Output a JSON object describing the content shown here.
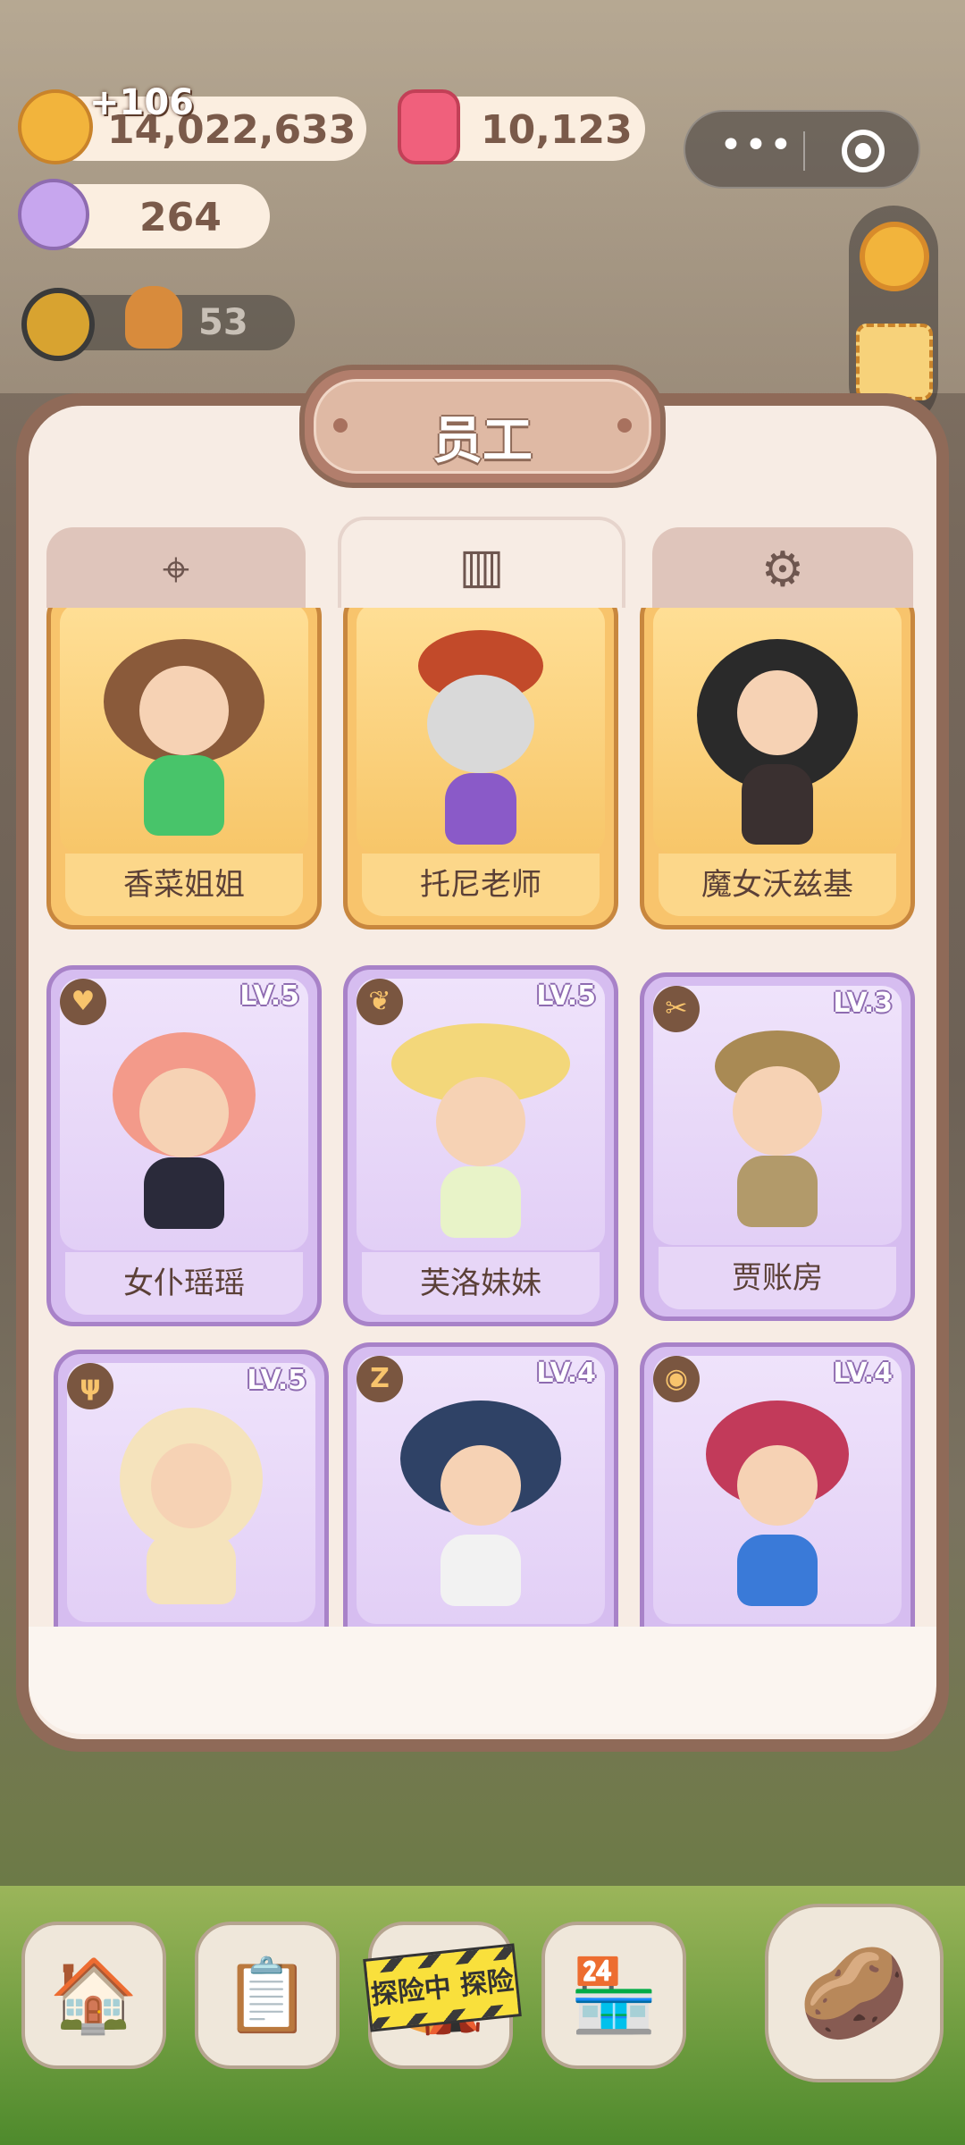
{
  "hud": {
    "coins_value": "14,022,633",
    "coins_gain": "+106",
    "candles_value": "10,123",
    "gems_value": "264",
    "sub_value": "53"
  },
  "capsule": {
    "more_label": "•••"
  },
  "panel": {
    "title": "员工",
    "tabs": [
      {
        "icon": "map-pin-icon"
      },
      {
        "icon": "book-icon",
        "active": true
      },
      {
        "icon": "gear-icon"
      }
    ]
  },
  "staff": [
    {
      "name": "香菜姐姐",
      "level": "",
      "rarity": "gold"
    },
    {
      "name": "托尼老师",
      "level": "",
      "rarity": "gold"
    },
    {
      "name": "魔女沃兹基",
      "level": "",
      "rarity": "gold"
    },
    {
      "name": "女仆瑶瑶",
      "level": "LV.5",
      "rarity": "purple",
      "badge": "♥"
    },
    {
      "name": "芙洛妹妹",
      "level": "LV.5",
      "rarity": "purple",
      "badge": "❦"
    },
    {
      "name": "贾账房",
      "level": "LV.3",
      "rarity": "purple",
      "badge": "✂"
    },
    {
      "name": "",
      "level": "LV.5",
      "rarity": "purple",
      "badge": "ψ"
    },
    {
      "name": "",
      "level": "LV.4",
      "rarity": "purple",
      "badge": "Z"
    },
    {
      "name": "",
      "level": "LV.4",
      "rarity": "purple",
      "badge": "◉"
    }
  ],
  "bottom_nav": {
    "banner_label": "探险中 探险"
  },
  "colors": {
    "gold_card": "#f8c46c",
    "purple_card": "#d6bdf0",
    "panel_border": "#8f6a58"
  }
}
